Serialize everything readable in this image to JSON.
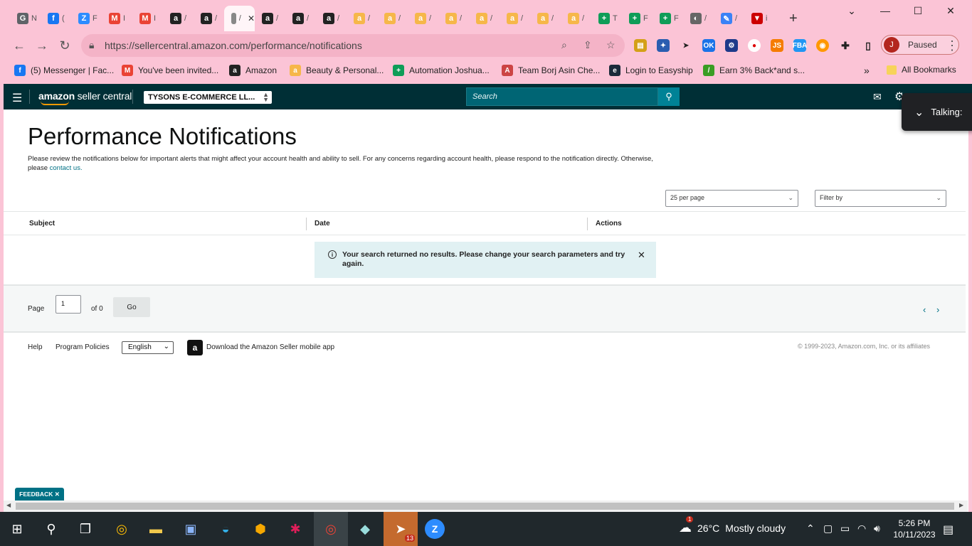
{
  "browser": {
    "tabs": [
      {
        "icon": "G",
        "letter": "N",
        "color": "#5f6368"
      },
      {
        "icon": "f",
        "letter": "(",
        "color": "#1877f2"
      },
      {
        "icon": "Z",
        "letter": "F",
        "color": "#2d8cff"
      },
      {
        "icon": "M",
        "letter": "I",
        "color": "#ea4335"
      },
      {
        "icon": "M",
        "letter": "I",
        "color": "#ea4335"
      },
      {
        "icon": "a",
        "letter": "/",
        "color": "#222"
      },
      {
        "icon": "a",
        "letter": "/",
        "color": "#222"
      },
      {
        "icon": "",
        "letter": "/",
        "color": "#888"
      },
      {
        "icon": "a",
        "letter": "/",
        "color": "#222"
      },
      {
        "icon": "a",
        "letter": "/",
        "color": "#222"
      },
      {
        "icon": "a",
        "letter": "/",
        "color": "#222"
      },
      {
        "icon": "a",
        "letter": "/",
        "color": "#f6b74a"
      },
      {
        "icon": "a",
        "letter": "/",
        "color": "#f6b74a"
      },
      {
        "icon": "a",
        "letter": "/",
        "color": "#f6b74a"
      },
      {
        "icon": "a",
        "letter": "/",
        "color": "#f6b74a"
      },
      {
        "icon": "a",
        "letter": "/",
        "color": "#f6b74a"
      },
      {
        "icon": "a",
        "letter": "/",
        "color": "#f6b74a"
      },
      {
        "icon": "a",
        "letter": "/",
        "color": "#f6b74a"
      },
      {
        "icon": "a",
        "letter": "/",
        "color": "#f6b74a"
      },
      {
        "icon": "+",
        "letter": "T",
        "color": "#0f9d58"
      },
      {
        "icon": "+",
        "letter": "F",
        "color": "#0f9d58"
      },
      {
        "icon": "+",
        "letter": "F",
        "color": "#0f9d58"
      },
      {
        "icon": "◐",
        "letter": "/",
        "color": "#666"
      },
      {
        "icon": "✎",
        "letter": "/",
        "color": "#3b82f6"
      },
      {
        "icon": "▼",
        "letter": "i",
        "color": "#c00"
      }
    ],
    "active_tab_close": "✕",
    "new_tab": "+",
    "window_controls": {
      "tabsearch": "⌄",
      "minimize": "—",
      "maximize": "☐",
      "close": "✕"
    },
    "url": "https://sellercentral.amazon.com/performance/notifications",
    "profile_initial": "J",
    "profile_status": "Paused",
    "bookmarks": [
      {
        "label": "(5) Messenger | Fac...",
        "icon": "f",
        "color": "#1877f2"
      },
      {
        "label": "You've been invited...",
        "icon": "M",
        "color": "#ea4335"
      },
      {
        "label": "Amazon",
        "icon": "a",
        "color": "#222"
      },
      {
        "label": "Beauty & Personal...",
        "icon": "a",
        "color": "#f6b74a"
      },
      {
        "label": "Automation Joshua...",
        "icon": "+",
        "color": "#0f9d58"
      },
      {
        "label": "Team Borj Asin Che...",
        "icon": "A",
        "color": "#c44"
      },
      {
        "label": "Login to Easyship",
        "icon": "e",
        "color": "#1b2a3a"
      },
      {
        "label": "Earn 3% Back*and s...",
        "icon": "/",
        "color": "#3a9d23"
      }
    ],
    "bookmarks_more": "»",
    "all_bookmarks": "All Bookmarks"
  },
  "header": {
    "logo_strong": "amazon",
    "logo_rest": " seller central",
    "store_name": "TYSONS E-COMMERCE LL...",
    "search_placeholder": "Search"
  },
  "talking_popup": "Talking:",
  "page": {
    "title": "Performance Notifications",
    "description": "Please review the notifications below for important alerts that might affect your account health and ability to sell. For any concerns regarding account health, please respond to the notification directly. Otherwise, please ",
    "contact_link": "contact us.",
    "per_page": "25 per page",
    "filter_by": "Filter by",
    "columns": [
      "Subject",
      "Date",
      "Actions"
    ],
    "empty_message": "Your search returned no results. Please change your search parameters and try again.",
    "pager": {
      "page_label": "Page",
      "page_value": "1",
      "of_label": "of 0",
      "go_label": "Go"
    }
  },
  "footer": {
    "help": "Help",
    "program_policies": "Program Policies",
    "language": "English",
    "app_link": "Download the Amazon Seller mobile app",
    "copyright": "© 1999-2023, Amazon.com, Inc. or its affiliates",
    "feedback": "FEEDBACK"
  },
  "taskbar": {
    "weather_badge": "1",
    "temperature": "26°C",
    "weather": "Mostly cloudy",
    "time": "5:26 PM",
    "date": "10/11/2023",
    "telegram_badge": "13"
  }
}
